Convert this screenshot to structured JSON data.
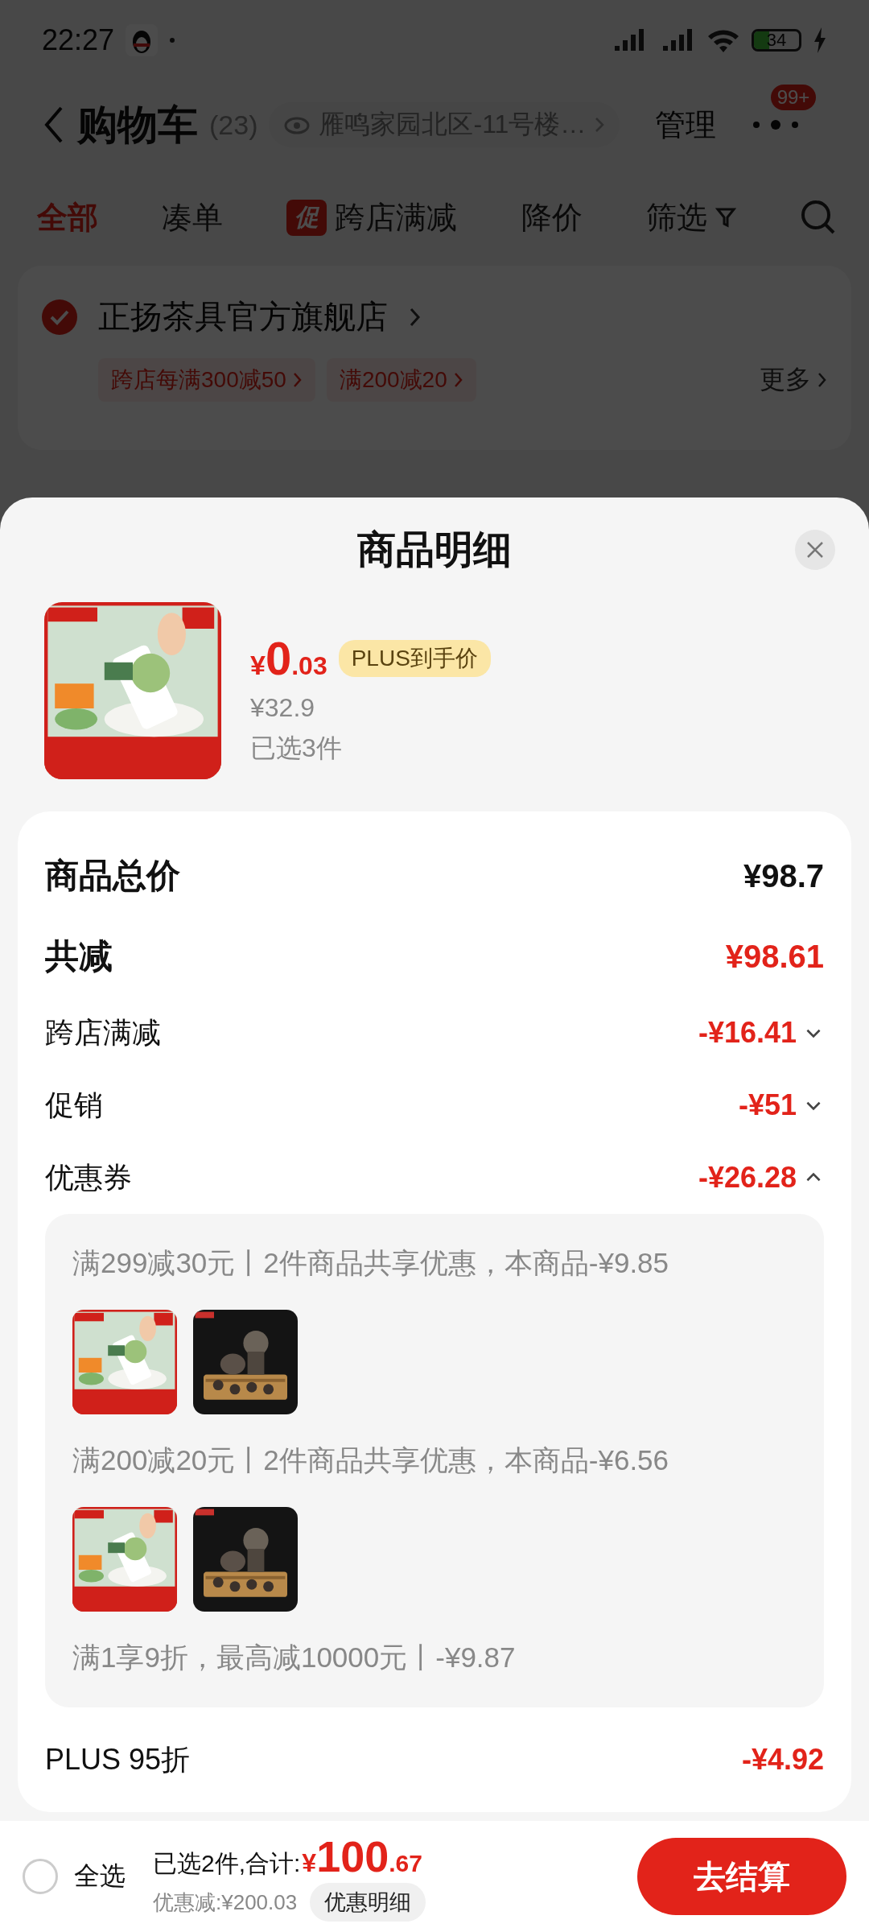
{
  "status_bar": {
    "time": "22:27",
    "battery": "34"
  },
  "header": {
    "title": "购物车",
    "count": "(23)",
    "address": "雁鸣家园北区-11号楼…",
    "manage": "管理",
    "badge": "99+"
  },
  "tabs": [
    {
      "label": "全部",
      "selected": true
    },
    {
      "label": "凑单",
      "selected": false
    },
    {
      "label": "跨店满减",
      "tag": "促",
      "selected": false
    },
    {
      "label": "降价",
      "selected": false
    },
    {
      "label": "筛选",
      "selected": false
    }
  ],
  "store": {
    "name": "正扬茶具官方旗舰店",
    "checked": true,
    "promos": [
      "跨店每满300减50",
      "满200减20"
    ],
    "more": "更多"
  },
  "sheet": {
    "title": "商品明细",
    "product": {
      "currency": "¥",
      "price_int": "0",
      "price_dec": ".03",
      "badge": "PLUS到手价",
      "original_price": "¥32.9",
      "selected_count": "已选3件"
    },
    "rows": [
      {
        "kind": "total",
        "label": "商品总价",
        "value": "¥98.7"
      },
      {
        "kind": "reduction",
        "label": "共减",
        "value": "¥98.61"
      },
      {
        "kind": "item",
        "label": "跨店满减",
        "value": "-¥16.41",
        "expanded": false
      },
      {
        "kind": "item",
        "label": "促销",
        "value": "-¥51",
        "expanded": false
      },
      {
        "kind": "item",
        "label": "优惠券",
        "value": "-¥26.28",
        "expanded": true,
        "details": [
          {
            "text": "满299减30元丨2件商品共享优惠，本商品-¥9.85"
          },
          {
            "text": "满200减20元丨2件商品共享优惠，本商品-¥6.56"
          },
          {
            "text": "满1享9折，最高减10000元丨-¥9.87"
          }
        ]
      },
      {
        "kind": "plain",
        "label": "PLUS 95折",
        "value": "-¥4.92"
      }
    ]
  },
  "footer": {
    "select_all": {
      "label": "全选",
      "checked": false
    },
    "summary": "已选2件,合计:",
    "currency": "¥",
    "total_int": "100",
    "total_dec": ".67",
    "saving": "优惠减:¥200.03",
    "detail_button": "优惠明细",
    "checkout": "去结算"
  }
}
